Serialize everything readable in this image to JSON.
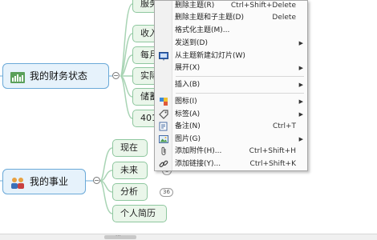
{
  "mindmap": {
    "main_topics": [
      {
        "label": "我的财务状态"
      },
      {
        "label": "我的事业"
      }
    ],
    "finance_subtopics": [
      "服务",
      "收入",
      "每月",
      "实际",
      "储蓄",
      "401"
    ],
    "career_subtopics": [
      "现在",
      "未来",
      "分析",
      "个人简历"
    ],
    "badges": {
      "future": "3",
      "analysis": "36"
    }
  },
  "context_menu": {
    "items": [
      {
        "label": "删除主题(R)",
        "shortcut": "Ctrl+Shift+Delete",
        "icon": ""
      },
      {
        "label": "删除主题和子主题(D)",
        "shortcut": "Delete",
        "icon": ""
      },
      {
        "label": "格式化主题(M)...",
        "shortcut": "",
        "icon": ""
      },
      {
        "label": "发送到(D)",
        "shortcut": "",
        "icon": ""
      },
      {
        "label": "从主题新建幻灯片(W)",
        "shortcut": "",
        "icon": "slide-icon"
      },
      {
        "label": "展开(X)",
        "shortcut": "",
        "icon": ""
      },
      {
        "label": "插入(B)",
        "shortcut": "",
        "icon": ""
      },
      {
        "label": "图标(I)",
        "shortcut": "",
        "icon": "icon-marker-icon"
      },
      {
        "label": "标签(A)",
        "shortcut": "",
        "icon": "tag-icon"
      },
      {
        "label": "备注(N)",
        "shortcut": "Ctrl+T",
        "icon": "note-icon"
      },
      {
        "label": "图片(G)",
        "shortcut": "",
        "icon": "picture-icon"
      },
      {
        "label": "添加附件(H)...",
        "shortcut": "Ctrl+Shift+H",
        "icon": "paperclip-icon"
      },
      {
        "label": "添加链接(Y)...",
        "shortcut": "Ctrl+Shift+K",
        "icon": "link-icon"
      }
    ]
  },
  "scrollbar": {
    "grip": "..."
  }
}
